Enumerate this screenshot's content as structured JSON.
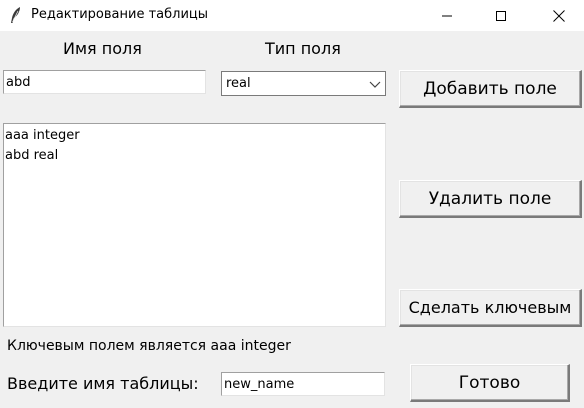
{
  "window": {
    "title": "Редактирование таблицы",
    "icon": "feather-icon",
    "controls": {
      "minimize": "minimize-icon",
      "maximize": "maximize-icon",
      "close": "close-icon"
    }
  },
  "fields_form": {
    "name_label": "Имя поля",
    "type_label": "Тип поля",
    "name_value": "abd",
    "type_value": "real",
    "add_button": "Добавить поле",
    "delete_button": "Удалить поле",
    "make_key_button": "Сделать ключевым"
  },
  "field_list": [
    {
      "label": "aaa integer"
    },
    {
      "label": "abd real"
    }
  ],
  "key_info": "Ключевым полем является aaa integer",
  "table_form": {
    "label": "Введите имя таблицы:",
    "value": "new_name",
    "done_button": "Готово"
  }
}
